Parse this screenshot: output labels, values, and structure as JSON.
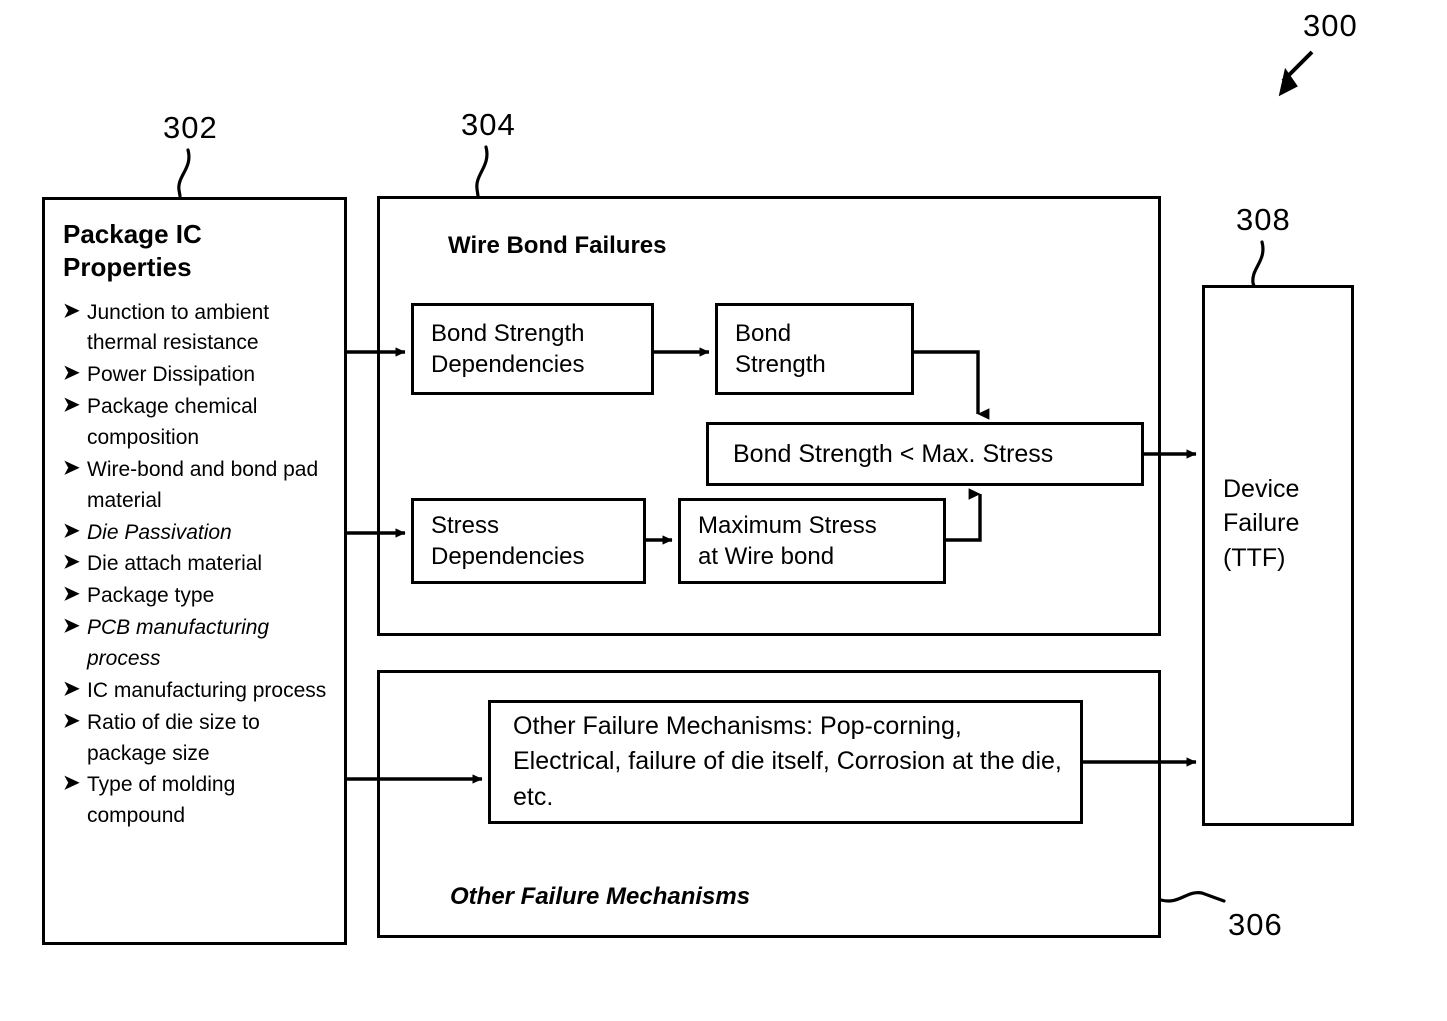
{
  "figure": {
    "number": "300",
    "refs": {
      "package_ic_properties": "302",
      "wire_bond_failures": "304",
      "other_failure_mechanisms": "306",
      "device_failure": "308"
    }
  },
  "properties_panel": {
    "title": "Package IC\nProperties",
    "bullet_glyph": "➤",
    "items": [
      {
        "text": "Junction to ambient thermal resistance",
        "italic": false
      },
      {
        "text": "Power Dissipation",
        "italic": false
      },
      {
        "text": "Package chemical composition",
        "italic": false
      },
      {
        "text": "Wire-bond and bond pad material",
        "italic": false
      },
      {
        "text": "Die Passivation",
        "italic": true
      },
      {
        "text": "Die attach material",
        "italic": false
      },
      {
        "text": "Package type",
        "italic": false
      },
      {
        "text": "PCB manufacturing process",
        "italic": true
      },
      {
        "text": "IC manufacturing process",
        "italic": false
      },
      {
        "text": "Ratio of die size to package size",
        "italic": false
      },
      {
        "text": "Type of molding compound",
        "italic": false
      }
    ]
  },
  "wire_bond_section": {
    "title": "Wire Bond Failures",
    "blocks": {
      "bond_strength_dependencies": "Bond Strength\nDependencies",
      "bond_strength": "Bond\nStrength",
      "comparator": "Bond Strength < Max. Stress",
      "stress_dependencies": "Stress\nDependencies",
      "maximum_stress": "Maximum Stress\nat Wire bond"
    }
  },
  "other_section": {
    "title": "Other Failure Mechanisms",
    "blocks": {
      "other_mechanisms": "Other Failure Mechanisms: Pop-corning, Electrical, failure of die itself, Corrosion at the die, etc."
    }
  },
  "device_failure": {
    "label": "Device\nFailure\n(TTF)"
  },
  "colors": {
    "stroke": "#000000",
    "background": "#ffffff"
  }
}
